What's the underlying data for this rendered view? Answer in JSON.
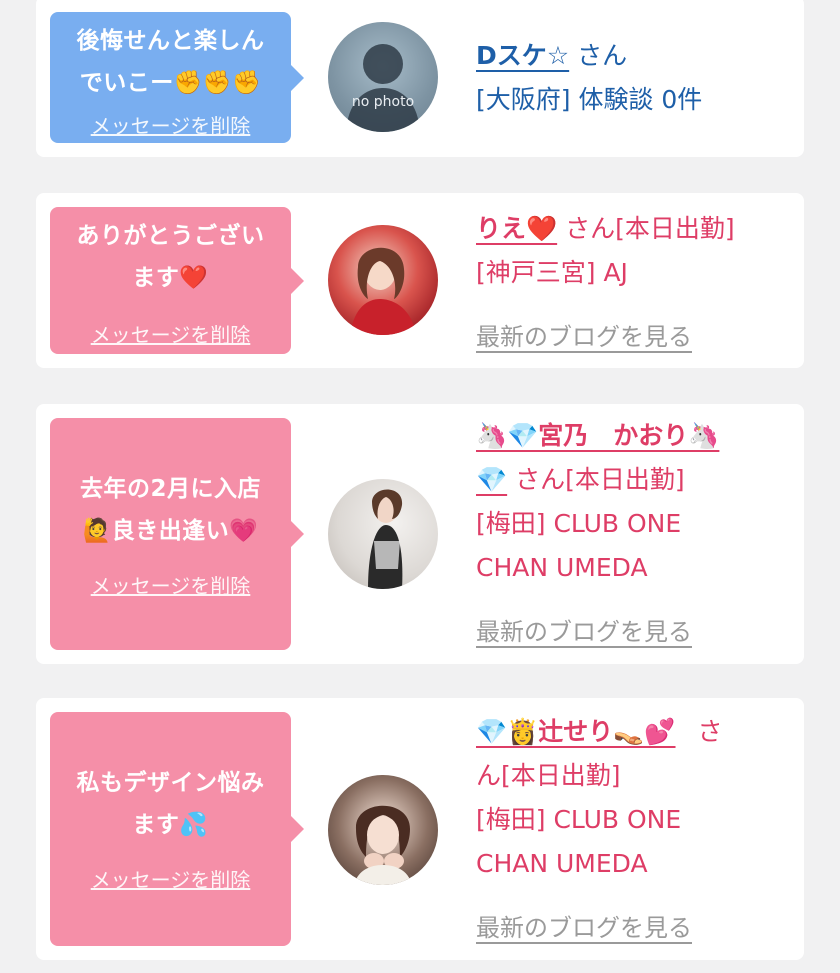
{
  "cards": [
    {
      "message_line1": "後悔せんと楽しん",
      "message_line2": "でいこー✊✊✊",
      "delete_label": "メッセージを削除",
      "avatar_text": "no photo",
      "name": "Dスケ☆",
      "honorific": " さん",
      "line2": "[大阪府] 体験談 0件"
    },
    {
      "message_line1": "ありがとうござい",
      "message_line2": "ます❤️",
      "delete_label": "メッセージを削除",
      "name": "りえ❤️",
      "honorific": " さん[本日出勤]",
      "line2": "[神戸三宮] AJ",
      "blog_label": "最新のブログを見る"
    },
    {
      "message_line1": "去年の2月に入店",
      "message_line2": "🙋良き出逢い💗",
      "delete_label": "メッセージを削除",
      "name_line1": "🦄💎宮乃　かおり🦄",
      "name_line2": "💎",
      "honorific": " さん[本日出勤]",
      "line3": "[梅田] CLUB ONE",
      "line4": "CHAN UMEDA",
      "blog_label": "最新のブログを見る"
    },
    {
      "message_line1": "私もデザイン悩み",
      "message_line2": "ます💦",
      "delete_label": "メッセージを削除",
      "name_line1": "💎👸辻せり👡💕",
      "honorific_a": " さ",
      "honorific_b": "ん[本日出勤]",
      "line3": "[梅田] CLUB ONE",
      "line4": "CHAN UMEDA",
      "blog_label": "最新のブログを見る"
    }
  ],
  "colors": {
    "bubble_blue": "#79aef0",
    "bubble_pink": "#f58fa8",
    "text_blue": "#1e5fa8",
    "text_pink": "#de3d66",
    "link_gray": "#9a9a9a"
  }
}
